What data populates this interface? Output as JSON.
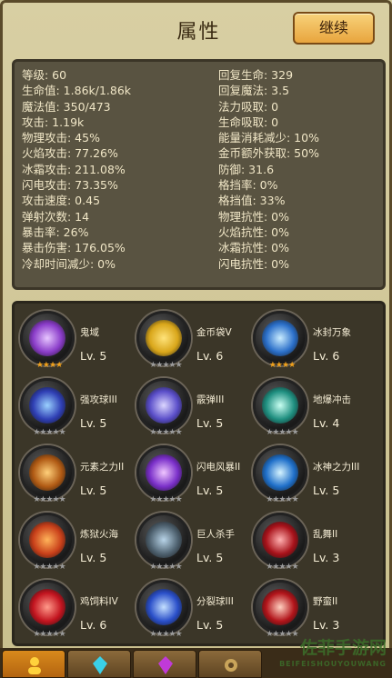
{
  "header": {
    "title": "属性",
    "continue_label": "继续"
  },
  "stats": {
    "left": [
      "等级: 60",
      "生命值: 1.86k/1.86k",
      "魔法值: 350/473",
      "攻击: 1.19k",
      "物理攻击: 45%",
      "火焰攻击: 77.26%",
      "冰霜攻击: 211.08%",
      "闪电攻击: 73.35%",
      "攻击速度: 0.45",
      "弹射次数: 14",
      "暴击率: 26%",
      "暴击伤害: 176.05%",
      "冷却时间减少: 0%"
    ],
    "right": [
      "回复生命: 329",
      "回复魔法: 3.5",
      "法力吸取: 0",
      "生命吸取: 0",
      "能量消耗减少: 10%",
      "金币额外获取: 50%",
      "防御: 31.6",
      "格挡率: 0%",
      "格挡值: 33%",
      "物理抗性: 0%",
      "火焰抗性: 0%",
      "冰霜抗性: 0%",
      "闪电抗性: 0%"
    ]
  },
  "skills": [
    {
      "name": "鬼域",
      "level": "Lv. 5",
      "color": "#8a3cc9",
      "glow": "#e7c6ff",
      "icon": "ghost-domain-icon",
      "star": true
    },
    {
      "name": "金币袋V",
      "level": "Lv. 6",
      "color": "#d9a61a",
      "glow": "#ffe37a",
      "icon": "gold-bag-icon",
      "star": false
    },
    {
      "name": "冰封万象",
      "level": "Lv. 6",
      "color": "#2b6fc9",
      "glow": "#c9ecff",
      "icon": "ice-seal-icon",
      "star": true
    },
    {
      "name": "强攻球III",
      "level": "Lv. 5",
      "color": "#2f3fb4",
      "glow": "#9ad1ff",
      "icon": "strike-orb-icon",
      "star": false
    },
    {
      "name": "霰弹III",
      "level": "Lv. 5",
      "color": "#5a4ec9",
      "glow": "#dcd6ff",
      "icon": "shotgun-icon",
      "star": false
    },
    {
      "name": "地爆冲击",
      "level": "Lv. 4",
      "color": "#1f8f80",
      "glow": "#c9fff2",
      "icon": "ground-blast-icon",
      "star": false
    },
    {
      "name": "元素之力II",
      "level": "Lv. 5",
      "color": "#b05a14",
      "glow": "#ffd07a",
      "icon": "element-power-icon",
      "star": false
    },
    {
      "name": "闪电风暴II",
      "level": "Lv. 5",
      "color": "#7a2fc9",
      "glow": "#f0c6ff",
      "icon": "lightning-storm-icon",
      "star": false
    },
    {
      "name": "冰神之力III",
      "level": "Lv. 5",
      "color": "#1f6fc9",
      "glow": "#d6f4ff",
      "icon": "ice-god-icon",
      "star": false
    },
    {
      "name": "炼狱火海",
      "level": "Lv. 5",
      "color": "#c9401a",
      "glow": "#ffb45a",
      "icon": "inferno-icon",
      "star": false
    },
    {
      "name": "巨人杀手",
      "level": "Lv. 5",
      "color": "#4f6270",
      "glow": "#b8d4e8",
      "icon": "giant-slayer-icon",
      "star": false
    },
    {
      "name": "乱舞II",
      "level": "Lv. 3",
      "color": "#a8121a",
      "glow": "#ffb0b0",
      "icon": "frenzy-icon",
      "star": false
    },
    {
      "name": "鸡饲料IV",
      "level": "Lv. 6",
      "color": "#c2141f",
      "glow": "#ff9a8a",
      "icon": "chicken-feed-icon",
      "star": false
    },
    {
      "name": "分裂球III",
      "level": "Lv. 5",
      "color": "#2a4fc9",
      "glow": "#c4e0ff",
      "icon": "split-orb-icon",
      "star": false
    },
    {
      "name": "野蛮II",
      "level": "Lv. 3",
      "color": "#b2141a",
      "glow": "#ffd0c0",
      "icon": "savage-icon",
      "star": false
    }
  ],
  "tabs": [
    {
      "icon": "character-icon",
      "active": true
    },
    {
      "icon": "blue-crystal-icon",
      "active": false
    },
    {
      "icon": "purple-crystal-icon",
      "active": false
    },
    {
      "icon": "gear-icon",
      "active": false
    }
  ],
  "watermark": {
    "main": "佐菲手游网",
    "sub": "BEIFEISHOUYOUWANG"
  }
}
